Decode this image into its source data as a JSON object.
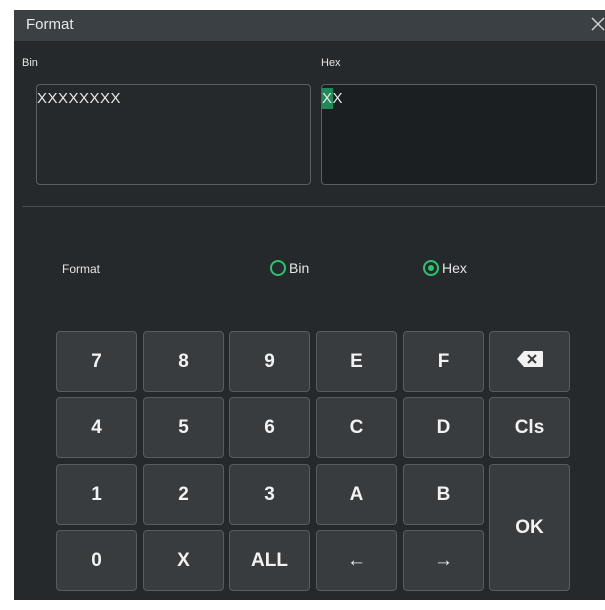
{
  "dialog": {
    "title": "Format",
    "close_icon": "close-icon"
  },
  "fields": {
    "bin": {
      "label": "Bin",
      "value": "XXXXXXXX"
    },
    "hex": {
      "label": "Hex",
      "value": "XX"
    }
  },
  "format": {
    "label": "Format",
    "options": [
      {
        "label": "Bin",
        "selected": false
      },
      {
        "label": "Hex",
        "selected": true
      }
    ]
  },
  "keypad": {
    "row1": [
      "7",
      "8",
      "9",
      "E",
      "F"
    ],
    "backspace_icon": "backspace-icon",
    "row2": [
      "4",
      "5",
      "6",
      "C",
      "D",
      "Cls"
    ],
    "row3": [
      "1",
      "2",
      "3",
      "A",
      "B"
    ],
    "row4": [
      "0",
      "X",
      "ALL",
      "←",
      "→"
    ],
    "ok": "OK"
  },
  "colors": {
    "accent": "#2bc46f",
    "background": "#25292b",
    "titlebar": "#3b4044",
    "key": "#383c3f"
  }
}
